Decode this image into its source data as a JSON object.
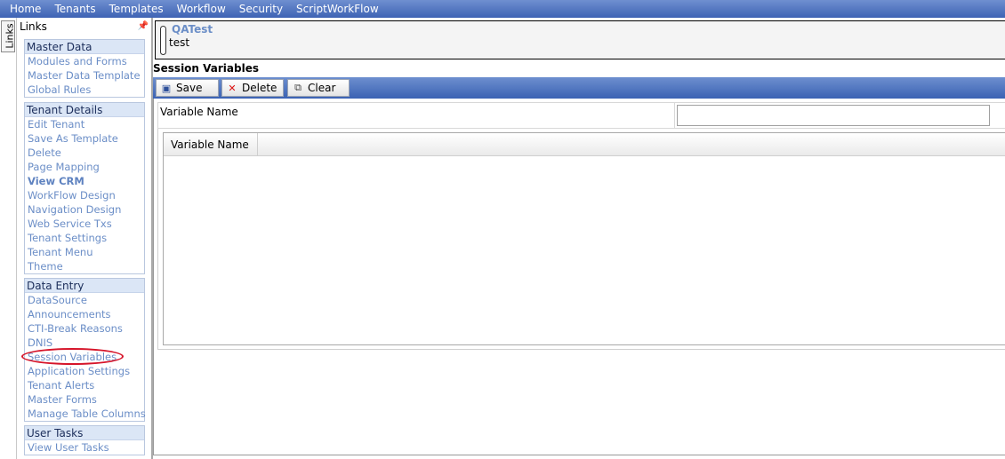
{
  "top_menu": [
    "Home",
    "Tenants",
    "Templates",
    "Workflow",
    "Security",
    "ScriptWorkFlow"
  ],
  "side_tab": "Links",
  "links_panel": {
    "title": "Links",
    "groups": [
      {
        "header": "Master Data",
        "items": [
          "Modules and Forms",
          "Master Data Template",
          "Global Rules"
        ]
      },
      {
        "header": "Tenant Details",
        "items": [
          "Edit Tenant",
          "Save As Template",
          "Delete",
          "Page Mapping",
          "View CRM",
          "WorkFlow Design",
          "Navigation Design",
          "Web Service Txs",
          "Tenant Settings",
          "Tenant Menu",
          "Theme"
        ]
      },
      {
        "header": "Data Entry",
        "items": [
          "DataSource",
          "Announcements",
          "CTI-Break Reasons",
          "DNIS",
          "Session Variables",
          "Application Settings",
          "Tenant Alerts",
          "Master Forms",
          "Manage Table Columns"
        ]
      },
      {
        "header": "User Tasks",
        "items": [
          "View User Tasks"
        ]
      }
    ]
  },
  "tenant": {
    "name": "QATest",
    "description": "test"
  },
  "section_title": "Session Variables",
  "toolbar": {
    "save": "Save",
    "delete": "Delete",
    "clear": "Clear"
  },
  "form": {
    "label": "Variable Name",
    "value": ""
  },
  "grid": {
    "columns": [
      "Variable Name"
    ],
    "rows": []
  }
}
